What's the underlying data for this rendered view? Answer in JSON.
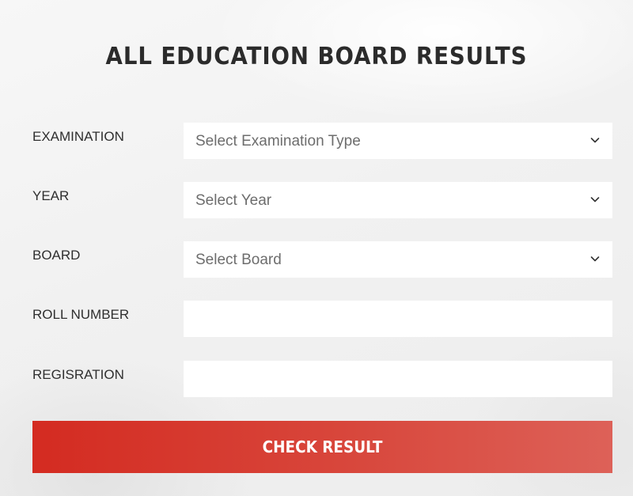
{
  "page": {
    "title": "ALL EDUCATION BOARD RESULTS"
  },
  "form": {
    "fields": [
      {
        "label": "EXAMINATION",
        "type": "select",
        "value": "Select Examination Type"
      },
      {
        "label": "YEAR",
        "type": "select",
        "value": "Select Year"
      },
      {
        "label": "BOARD",
        "type": "select",
        "value": "Select Board"
      },
      {
        "label": "ROLL NUMBER",
        "type": "text",
        "value": ""
      },
      {
        "label": "REGISRATION",
        "type": "text",
        "value": ""
      }
    ],
    "submit_label": "CHECK RESULT"
  },
  "colors": {
    "accent": "#d42b21",
    "title_text": "#2b2b2b",
    "label_text": "#2f2f2f",
    "select_text": "#6d6d6d"
  },
  "icons": {
    "select_arrow": "chevron-down-icon"
  }
}
